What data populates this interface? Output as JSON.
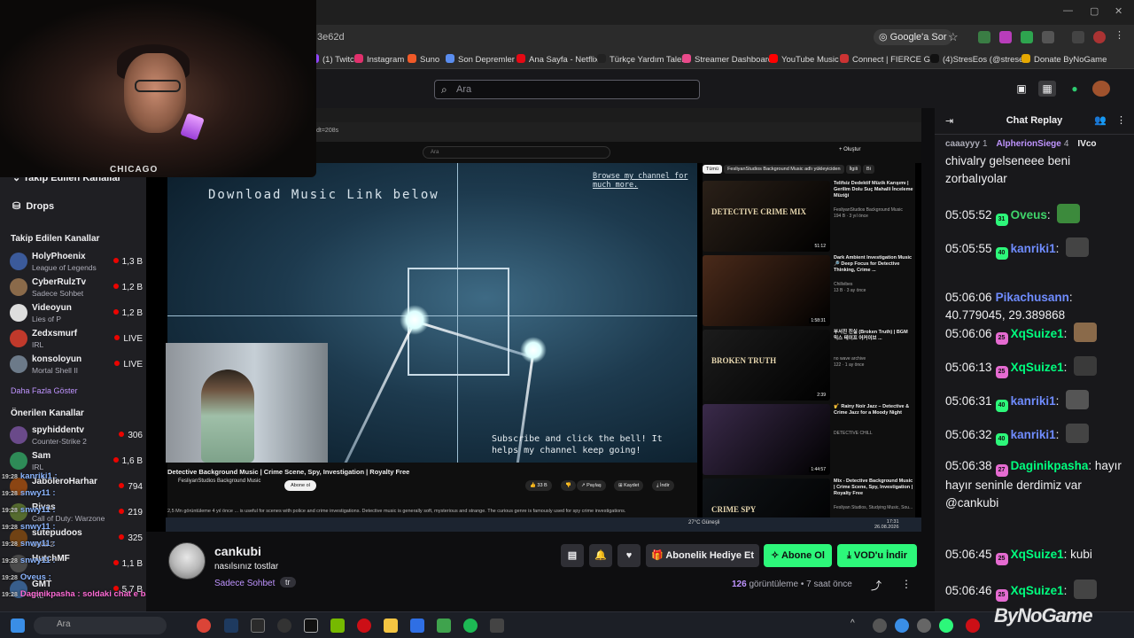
{
  "browser": {
    "url_fragment": "3e62d",
    "search_button": "Google'a Sor",
    "bookmarks": [
      {
        "label": "(1) Twitch",
        "color": "#9146ff"
      },
      {
        "label": "Instagram",
        "color": "#e1306c"
      },
      {
        "label": "Suno",
        "color": "#f05a28"
      },
      {
        "label": "Son Depremler",
        "color": "#5a8dee"
      },
      {
        "label": "Ana Sayfa - Netflix",
        "color": "#e50914"
      },
      {
        "label": "Türkçe Yardım Talebi",
        "color": "#222"
      },
      {
        "label": "Streamer Dashboard",
        "color": "#e94a8a"
      },
      {
        "label": "YouTube Music",
        "color": "#ff0000"
      },
      {
        "label": "Connect | FIERCE G...",
        "color": "#c33"
      },
      {
        "label": "(4)StresEos (@strese...",
        "color": "#111"
      },
      {
        "label": "Donate ByNoGame",
        "color": "#e6a800"
      }
    ]
  },
  "topnav": {
    "search_placeholder": "Ara"
  },
  "sidebar": {
    "collapsed_label": "Takip Edilen Kanallar",
    "drops_label": "Drops",
    "followed_title": "Takip Edilen Kanallar",
    "followed": [
      {
        "name": "HolyPhoenix",
        "game": "League of Legends",
        "viewers": "1,3 B",
        "color": "#3b5a9a"
      },
      {
        "name": "CyberRulzTv",
        "game": "Sadece Sohbet",
        "viewers": "1,2 B",
        "color": "#8a6a4a"
      },
      {
        "name": "Videoyun",
        "game": "Lies of P",
        "viewers": "1,2 B",
        "color": "#ddd"
      },
      {
        "name": "Zedxsmurf",
        "game": "IRL",
        "viewers": "LIVE",
        "color": "#c0392b"
      },
      {
        "name": "konsoloyun",
        "game": "Mortal Shell II",
        "viewers": "LIVE",
        "color": "#6c7a89"
      }
    ],
    "show_more": "Daha Fazla Göster",
    "recommended_title": "Önerilen Kanallar",
    "recommended": [
      {
        "name": "spyhiddentv",
        "game": "Counter-Strike 2",
        "viewers": "306",
        "color": "#6a4a8a"
      },
      {
        "name": "Sam",
        "game": "IRL",
        "viewers": "1,6 B",
        "color": "#2e8b57"
      },
      {
        "name": "JaboleroHarhar",
        "game": "",
        "viewers": "794",
        "color": "#8b4513"
      },
      {
        "name": "Rivas",
        "game": "Call of Duty: Warzone",
        "viewers": "219",
        "color": "#556b2f"
      },
      {
        "name": "sutepudoos",
        "game": "Dota 2",
        "viewers": "325",
        "color": "#704214"
      },
      {
        "name": "HutchMF",
        "game": "",
        "viewers": "1,1 B",
        "color": "#4a4a4a"
      },
      {
        "name": "GMT",
        "game": "IRL",
        "viewers": "5,7 B",
        "color": "#385e8c"
      }
    ]
  },
  "overlay_chat": [
    {
      "time": "19:28",
      "text": "kanriki1 :"
    },
    {
      "time": "19:28",
      "text": "snwy11 :"
    },
    {
      "time": "19:28",
      "text": "snwy11 :"
    },
    {
      "time": "19:28",
      "text": "snwy11 :"
    },
    {
      "time": "19:28",
      "text": "snwy11 :"
    },
    {
      "time": "19:28",
      "text": "snwy11 :"
    },
    {
      "time": "19:28",
      "text": "Oveus :"
    },
    {
      "time": "19:28",
      "text": "Daginikpasha : soldaki chat e bak"
    }
  ],
  "webcam": {
    "shirt_text": "CHICAGO"
  },
  "inner_browser": {
    "url": "dt=208s",
    "yt_search": "Ara",
    "create_label": "Oluştur"
  },
  "video": {
    "title_overlay": "Download Music Link below",
    "top_right_text": "Browse my channel for much more.",
    "subscribe_text": "Subscribe and click the bell! It helps my channel keep going!",
    "yt_title": "Detective Background Music | Crime Scene, Spy, Investigation | Royalty Free",
    "yt_channel": "FesliyanStudios Background Music",
    "subscribe_button": "Abone ol",
    "likes": "33 B",
    "share": "Paylaş",
    "save": "Kaydet",
    "download": "İndir",
    "desc_line1": "2,5 Mn görüntüleme  4 yıl önce",
    "desc_line2": "... is useful for scenes with police and crime investigations. Detective music is generally soft, mysterious and strange. The curious genre is famously used for spy crime investigations."
  },
  "recommendations": {
    "chips": [
      "Tümü",
      "FesliyanStudios Background Music adlı yükleyiciden",
      "İlgili",
      "Bi"
    ],
    "items": [
      {
        "title": "Telifsiz Dedektif Müzik Karışımı | Gerilim Dolu Suç Mahalli İnceleme Müziği",
        "channel": "FesliyanStudios Background Music",
        "meta": "194 B · 3 yıl önce",
        "duration": "51:12",
        "thumb_text": "DETECTIVE CRIME MIX",
        "bg": "#2a2018"
      },
      {
        "title": "Dark Ambient Investigation Music 🔎 Deep Focus for Detective Thinking, Crime ...",
        "channel": "Chillvibes",
        "meta": "13 B · 3 ay önce",
        "duration": "1:58:31",
        "thumb_text": "",
        "bg": "#4a2a1a"
      },
      {
        "title": "부서진 진실 (Broken Truth) | BGM 믹스 테이프 어커이브 ...",
        "channel": "no wave archive",
        "meta": "122 · 1 ay önce",
        "duration": "2:39",
        "thumb_text": "BROKEN TRUTH",
        "bg": "#1c1c1c"
      },
      {
        "title": "🎷 Rainy Noir Jazz – Detective & Crime Jazz for a Moody Night",
        "channel": "DETECTIVE CHILL",
        "meta": "",
        "duration": "1:44:57",
        "thumb_text": "",
        "bg": "#3a2a4a"
      },
      {
        "title": "Mix - Detective Background Music | Crime Scene, Spy, Investigation | Royalty Free",
        "channel": "Fesliyan Studios, Studying Music, Sou...",
        "meta": "",
        "duration": "",
        "thumb_text": "CRIME SPY",
        "bg": "#101418"
      }
    ]
  },
  "inner_taskbar": {
    "weather": "27°C  Güneşli",
    "time": "17:31",
    "date": "26.08.2026"
  },
  "channel": {
    "name": "cankubi",
    "title": "nasılsınız tostlar",
    "category": "Sadece Sohbet",
    "tag": "tr",
    "gift_button": "Abonelik Hediye Et",
    "subscribe_button": "Abone Ol",
    "vod_button": "VOD'u İndir",
    "views_count": "126",
    "views_label": "görüntüleme",
    "age": "7 saat önce"
  },
  "chat": {
    "title": "Chat Replay",
    "top_users": [
      {
        "name": "caaayyy",
        "count": "1"
      },
      {
        "name": "AlpherionSiege",
        "count": "4"
      },
      {
        "name": "IVco",
        "count": ""
      }
    ],
    "messages": [
      {
        "time": "",
        "user": "",
        "badge": "",
        "text": "chivalry gelseneee beni zorbalıyolar",
        "class": ""
      },
      {
        "time": "05:05:52",
        "user": "Oveus",
        "badge": "31",
        "text": "",
        "class": "u-green"
      },
      {
        "time": "05:05:55",
        "user": "kanriki1",
        "badge": "40",
        "text": "",
        "class": "u-blue"
      },
      {
        "time": "05:06:06",
        "user": "Pikachusann",
        "badge": "",
        "text": "40.779045, 29.389868",
        "class": "u-blue"
      },
      {
        "time": "05:06:06",
        "user": "XqSuize1",
        "badge": "25",
        "text": "",
        "class": "u-mag"
      },
      {
        "time": "05:06:13",
        "user": "XqSuize1",
        "badge": "25",
        "text": "",
        "class": "u-mag"
      },
      {
        "time": "05:06:31",
        "user": "kanriki1",
        "badge": "40",
        "text": "",
        "class": "u-blue"
      },
      {
        "time": "05:06:32",
        "user": "kanriki1",
        "badge": "40",
        "text": "",
        "class": "u-blue"
      },
      {
        "time": "05:06:38",
        "user": "Daginikpasha",
        "badge": "27",
        "text": "hayır hayır seninle derdimiz var @cankubi",
        "class": "u-mag"
      },
      {
        "time": "05:06:45",
        "user": "XqSuize1",
        "badge": "25",
        "text": "kubi",
        "class": "u-mag"
      },
      {
        "time": "05:06:46",
        "user": "XqSuize1",
        "badge": "25",
        "text": "",
        "class": "u-mag"
      }
    ]
  },
  "taskbar": {
    "search_placeholder": "Ara",
    "watermark": "ByNoGame"
  }
}
